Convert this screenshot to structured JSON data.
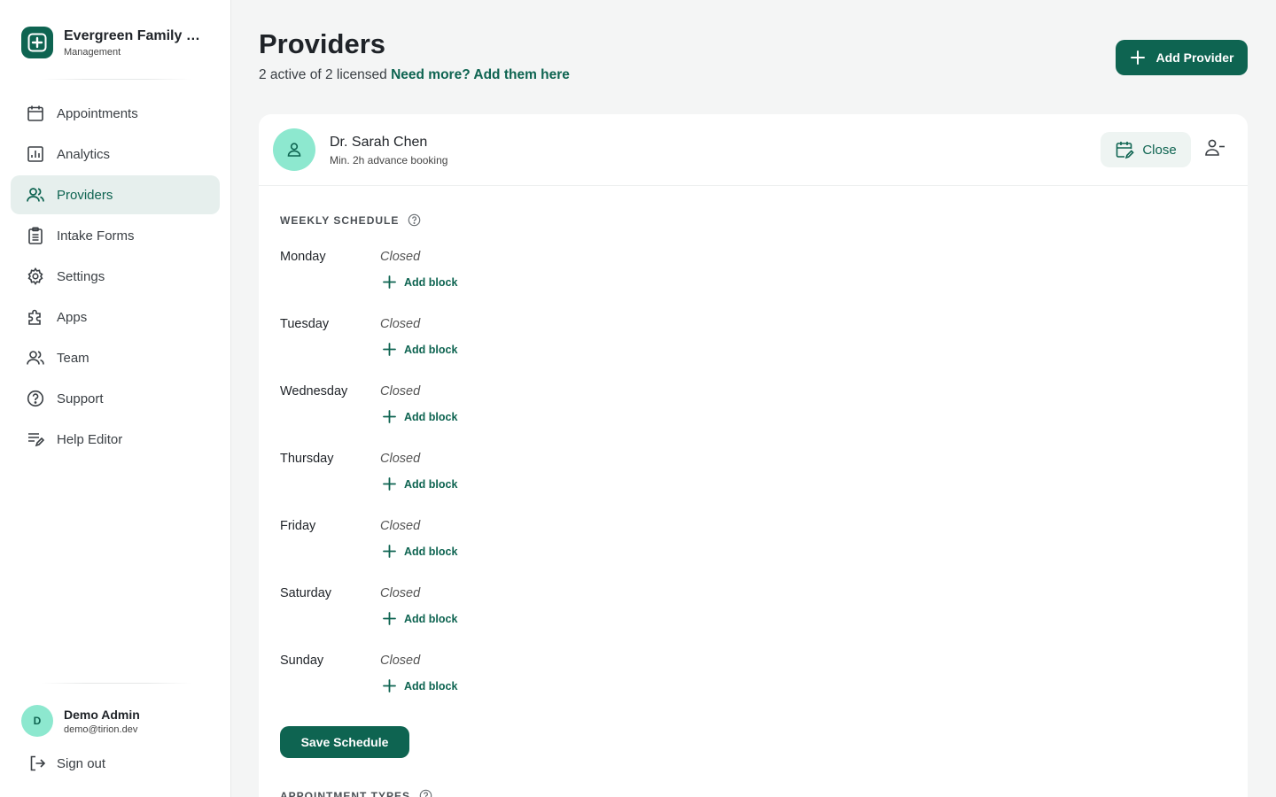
{
  "brand": {
    "name": "Evergreen Family D...",
    "subtitle": "Management"
  },
  "nav": [
    {
      "label": "Appointments",
      "icon": "calendar-icon",
      "active": false
    },
    {
      "label": "Analytics",
      "icon": "bar-chart-icon",
      "active": false
    },
    {
      "label": "Providers",
      "icon": "users-icon",
      "active": true
    },
    {
      "label": "Intake Forms",
      "icon": "clipboard-icon",
      "active": false
    },
    {
      "label": "Settings",
      "icon": "gear-icon",
      "active": false
    },
    {
      "label": "Apps",
      "icon": "puzzle-icon",
      "active": false
    },
    {
      "label": "Team",
      "icon": "team-icon",
      "active": false
    },
    {
      "label": "Support",
      "icon": "help-circle-icon",
      "active": false
    },
    {
      "label": "Help Editor",
      "icon": "list-edit-icon",
      "active": false
    }
  ],
  "user": {
    "initial": "D",
    "name": "Demo Admin",
    "email": "demo@tirion.dev",
    "signout_label": "Sign out"
  },
  "header": {
    "title": "Providers",
    "subtitle": "2 active of 2 licensed",
    "subtitle_link": "Need more? Add them here",
    "add_button_label": "Add Provider"
  },
  "provider": {
    "name": "Dr. Sarah Chen",
    "meta": "Min. 2h advance booking",
    "close_label": "Close"
  },
  "schedule": {
    "section_label": "WEEKLY SCHEDULE",
    "add_block_label": "Add block",
    "days": [
      {
        "name": "Monday",
        "status": "Closed"
      },
      {
        "name": "Tuesday",
        "status": "Closed"
      },
      {
        "name": "Wednesday",
        "status": "Closed"
      },
      {
        "name": "Thursday",
        "status": "Closed"
      },
      {
        "name": "Friday",
        "status": "Closed"
      },
      {
        "name": "Saturday",
        "status": "Closed"
      },
      {
        "name": "Sunday",
        "status": "Closed"
      }
    ],
    "save_label": "Save Schedule"
  },
  "next_section_label": "APPOINTMENT TYPES",
  "colors": {
    "accent": "#0e6451",
    "active_bg": "#e6efed",
    "avatar_bg": "#8de8cf"
  }
}
